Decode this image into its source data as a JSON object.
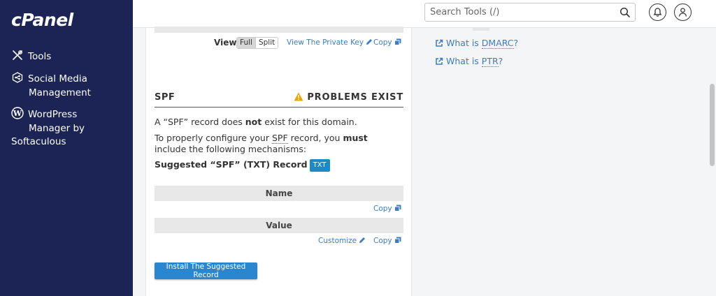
{
  "app": {
    "logo_text": "cPanel"
  },
  "sidebar": {
    "items": [
      {
        "label": "Tools",
        "icon": "tools-icon"
      },
      {
        "label_line1": "Social Media",
        "label_line2": "Management",
        "icon": "social-media-icon"
      },
      {
        "label_line1": "WordPress",
        "label_line2": "Manager by",
        "label_line3": "Softaculous",
        "icon": "wordpress-icon"
      }
    ]
  },
  "header": {
    "search_placeholder": "Search Tools (/)",
    "search_icon": "search-icon",
    "notifications_icon": "bell-icon",
    "user_icon": "user-icon"
  },
  "dkim_section": {
    "view_label": "View:",
    "view_options": [
      "Full",
      "Split"
    ],
    "view_selected": "Full",
    "private_key_link": "View The Private Key",
    "copy_link": "Copy"
  },
  "spf_section": {
    "title": "SPF",
    "status": "PROBLEMS EXIST",
    "status_color": "#e8a400",
    "para1_prefix": "A “SPF” record does ",
    "para1_bold": "not",
    "para1_suffix": " exist for this domain.",
    "para2_prefix": "To properly configure your ",
    "para2_abbr": "SPF",
    "para2_mid": " record, you ",
    "para2_bold": "must",
    "para2_suffix": " include the following mechanisms:",
    "suggested_label": "Suggested “SPF” (TXT) Record",
    "txt_badge": "TXT",
    "name_header": "Name",
    "name_copy": "Copy",
    "value_header": "Value",
    "value_customize": "Customize",
    "value_copy": "Copy",
    "install_button": "Install The Suggested Record"
  },
  "right_links": [
    {
      "prefix": "What is ",
      "abbr": "DMARC",
      "suffix": "?"
    },
    {
      "prefix": "What is ",
      "abbr": "PTR",
      "suffix": "?"
    }
  ],
  "colors": {
    "sidebar_bg": "#1b2454",
    "link": "#3a7dc4",
    "badge": "#1d8ac7",
    "button": "#2a86cf"
  }
}
